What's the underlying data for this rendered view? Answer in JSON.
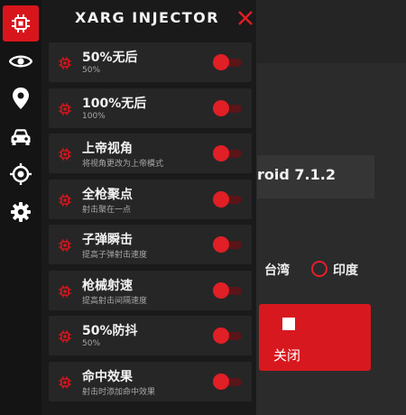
{
  "app": {
    "title": "XARG INJECTOR",
    "accent": "#e01f26"
  },
  "sidebar": {
    "items": [
      {
        "icon": "chip-icon",
        "active": true
      },
      {
        "icon": "eye-icon",
        "active": false
      },
      {
        "icon": "location-pin-icon",
        "active": false
      },
      {
        "icon": "car-icon",
        "active": false
      },
      {
        "icon": "crosshair-icon",
        "active": false
      },
      {
        "icon": "gear-icon",
        "active": false
      }
    ]
  },
  "menu": {
    "items": [
      {
        "title": "50%无后",
        "sub": "50%",
        "on": true
      },
      {
        "title": "100%无后",
        "sub": "100%",
        "on": true
      },
      {
        "title": "上帝视角",
        "sub": "将视角更改为上帝模式",
        "on": true
      },
      {
        "title": "全枪聚点",
        "sub": "射击聚在一点",
        "on": true
      },
      {
        "title": "子弹瞬击",
        "sub": "提高子弹射击速度",
        "on": true
      },
      {
        "title": "枪械射速",
        "sub": "提高射击间隔速度",
        "on": true
      },
      {
        "title": "50%防抖",
        "sub": "50%",
        "on": true
      },
      {
        "title": "命中效果",
        "sub": "射击时添加命中效果",
        "on": true
      }
    ]
  },
  "background": {
    "android_text": "roid 7.1.2",
    "region_taiwan": "台湾",
    "region_india": "印度",
    "stop_label": "关闭"
  }
}
